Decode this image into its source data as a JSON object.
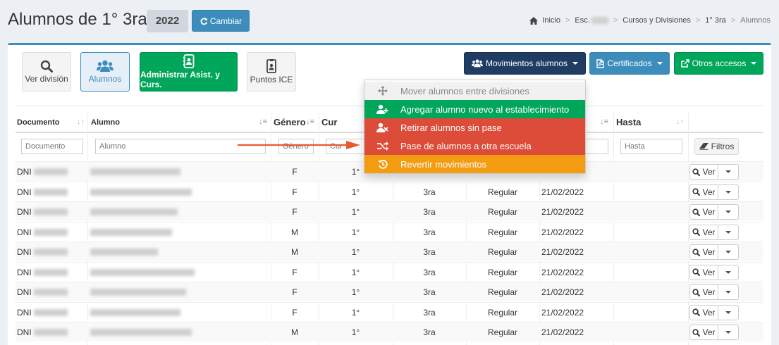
{
  "header": {
    "title": "Alumnos de 1° 3ra -",
    "year": "2022",
    "change_button": "Cambiar"
  },
  "breadcrumb": [
    {
      "label": "Inicio",
      "icon": "home-icon"
    },
    {
      "label": "Esc."
    },
    {
      "label": "Cursos y Divisiones"
    },
    {
      "label": "1° 3ra"
    },
    {
      "label": "Alumnos"
    }
  ],
  "tiles": [
    {
      "label": "Ver división",
      "icon": "search-icon"
    },
    {
      "label": "Alumnos",
      "icon": "users-icon"
    },
    {
      "label": "Administrar Asist. y Curs.",
      "icon": "contact-book-icon"
    },
    {
      "label": "Puntos ICE",
      "icon": "id-badge-icon"
    }
  ],
  "toolbar": {
    "movimientos": "Movimientos alumnos",
    "certificados": "Certificados",
    "otros": "Otros accesos"
  },
  "dropdown": [
    {
      "label": "Mover alumnos entre divisiones",
      "icon": "move-arrows-icon",
      "style": "gray"
    },
    {
      "label": "Agregar alumno nuevo al establecimiento",
      "icon": "user-plus-icon",
      "style": "green"
    },
    {
      "label": "Retirar alumnos sin pase",
      "icon": "user-times-icon",
      "style": "red"
    },
    {
      "label": "Pase de alumnos a otra escuela",
      "icon": "random-icon",
      "style": "red"
    },
    {
      "label": "Revertir movimientos",
      "icon": "history-icon",
      "style": "orange"
    }
  ],
  "table": {
    "headers": {
      "documento": "Documento",
      "alumno": "Alumno",
      "genero": "Género",
      "curso": "Cur",
      "hasta": "Hasta"
    },
    "filters": {
      "documento": "Documento",
      "alumno": "Alumno",
      "genero": "Género",
      "curso": "Cur",
      "hasta": "Hasta"
    },
    "filters_button": "Filtros",
    "ver_label": "Ver",
    "rows": [
      {
        "doc": "DNI",
        "genero": "F",
        "curso": "1°",
        "division": "",
        "condicion": "",
        "desde": ""
      },
      {
        "doc": "DNI",
        "genero": "F",
        "curso": "1°",
        "division": "3ra",
        "condicion": "Regular",
        "desde": "21/02/2022"
      },
      {
        "doc": "DNI",
        "genero": "F",
        "curso": "1°",
        "division": "3ra",
        "condicion": "Regular",
        "desde": "21/02/2022"
      },
      {
        "doc": "DNI",
        "genero": "M",
        "curso": "1°",
        "division": "3ra",
        "condicion": "Regular",
        "desde": "21/02/2022"
      },
      {
        "doc": "DNI",
        "genero": "M",
        "curso": "1°",
        "division": "3ra",
        "condicion": "Regular",
        "desde": "21/02/2022"
      },
      {
        "doc": "DNI",
        "genero": "F",
        "curso": "1°",
        "division": "3ra",
        "condicion": "Regular",
        "desde": "21/02/2022"
      },
      {
        "doc": "DNI",
        "genero": "F",
        "curso": "1°",
        "division": "3ra",
        "condicion": "Regular",
        "desde": "21/02/2022"
      },
      {
        "doc": "DNI",
        "genero": "F",
        "curso": "1°",
        "division": "3ra",
        "condicion": "Regular",
        "desde": "21/02/2022"
      },
      {
        "doc": "DNI",
        "genero": "M",
        "curso": "1°",
        "division": "3ra",
        "condicion": "Regular",
        "desde": "21/02/2022"
      }
    ]
  },
  "colors": {
    "primary": "#3c8dbc",
    "navy": "#1f3d63",
    "success": "#00a65a",
    "danger": "#dd4b39",
    "warning": "#f39c12",
    "annotation_arrow": "#e8592b"
  }
}
